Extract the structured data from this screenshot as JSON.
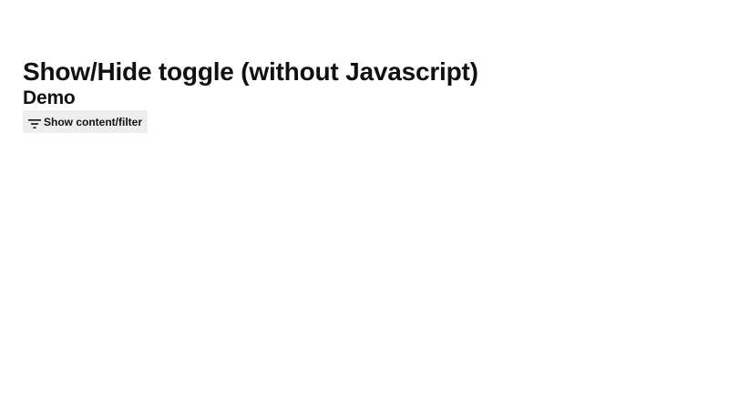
{
  "page": {
    "title": "Show/Hide toggle (without Javascript)",
    "section_title": "Demo"
  },
  "toggle": {
    "icon": "filter-icon",
    "label": "Show content/filter"
  }
}
